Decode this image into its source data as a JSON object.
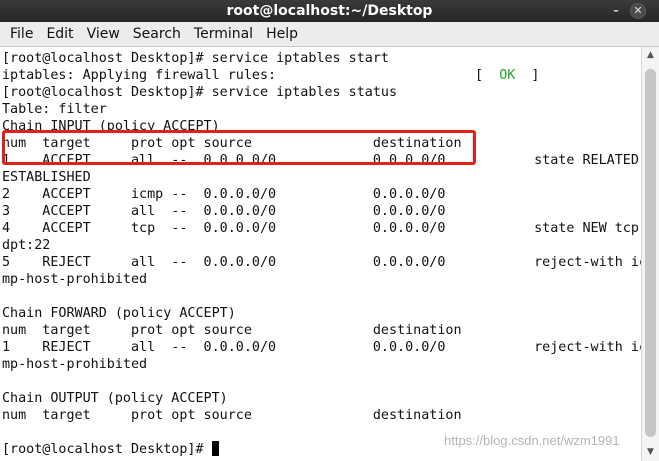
{
  "window": {
    "title": "root@localhost:~/Desktop",
    "minimize_glyph": "–",
    "close_glyph": "✕"
  },
  "menu": [
    {
      "label": "File"
    },
    {
      "label": "Edit"
    },
    {
      "label": "View"
    },
    {
      "label": "Search"
    },
    {
      "label": "Terminal"
    },
    {
      "label": "Help"
    }
  ],
  "terminal": {
    "prompt_cmd_start": "[root@localhost Desktop]# service iptables start",
    "applying_rules": "iptables: Applying firewall rules:",
    "ok_open": "[  ",
    "ok_text": "OK",
    "ok_close": "  ]",
    "prompt_cmd_status": "[root@localhost Desktop]# service iptables status",
    "table": "Table: filter",
    "chain_input": "Chain INPUT (policy ACCEPT)",
    "header_1": "num  target     prot opt source               destination",
    "input_rule_1": "1    ACCEPT     all  --  0.0.0.0/0            0.0.0.0/0           state RELATED,",
    "input_rule_1_wrap": "ESTABLISHED",
    "input_rule_2": "2    ACCEPT     icmp --  0.0.0.0/0            0.0.0.0/0",
    "input_rule_3": "3    ACCEPT     all  --  0.0.0.0/0            0.0.0.0/0",
    "input_rule_4": "4    ACCEPT     tcp  --  0.0.0.0/0            0.0.0.0/0           state NEW tcp",
    "input_rule_4_wrap": "dpt:22",
    "input_rule_5": "5    REJECT     all  --  0.0.0.0/0            0.0.0.0/0           reject-with ic",
    "input_rule_5_wrap": "mp-host-prohibited",
    "chain_forward": "Chain FORWARD (policy ACCEPT)",
    "header_2": "num  target     prot opt source               destination",
    "forward_rule_1": "1    REJECT     all  --  0.0.0.0/0            0.0.0.0/0           reject-with ic",
    "forward_rule_1_wrap": "mp-host-prohibited",
    "chain_output": "Chain OUTPUT (policy ACCEPT)",
    "header_3": "num  target     prot opt source               destination",
    "prompt_final": "[root@localhost Desktop]# "
  },
  "watermark": "https://blog.csdn.net/wzm1991",
  "colors": {
    "ok": "#22a12e",
    "highlight_box": "#e0201b",
    "titlebar": "#2e2e2e"
  }
}
